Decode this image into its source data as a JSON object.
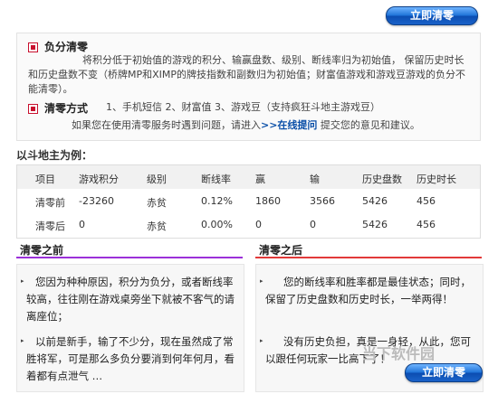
{
  "top_button": {
    "label": "立即清零"
  },
  "bottom_button": {
    "label": "立即清零"
  },
  "info": {
    "negative": {
      "title": "负分清零",
      "body": "将积分低于初始值的游戏的积分、输赢盘数、级别、断线率归为初始值， 保留历史时长和历史盘数不变（桥牌MP和XIMP的牌技指数和副数归为初始值；财富值游戏和游戏豆游戏的负分不能清零）。"
    },
    "method": {
      "title": "清零方式",
      "options": "1、手机短信 2、财富值 3、游戏豆（支持疯狂斗地主游戏豆）",
      "help_prefix": "如果您在使用清零服务时遇到问题，请进入",
      "help_link": ">>在线提问",
      "help_suffix": " 提交您的意见和建议。"
    }
  },
  "example": {
    "title": "以斗地主为例：",
    "headers": [
      "项目",
      "游戏积分",
      "级别",
      "断线率",
      "赢",
      "输",
      "历史盘数",
      "历史时长"
    ],
    "rows": [
      [
        "清零前",
        "-23260",
        "赤贫",
        "0.12%",
        "1860",
        "3566",
        "5426",
        "456"
      ],
      [
        "清零后",
        "0",
        "赤贫",
        "0.00%",
        "0",
        "0",
        "5426",
        "456"
      ]
    ]
  },
  "before": {
    "title": "清零之前",
    "p1": "您因为种种原因，积分为负分，或者断线率较高，往往刚在游戏桌旁坐下就被不客气的请离座位；",
    "p2": "以前是新手，输了不少分，现在虽然成了常胜将军，可是那么多负分要消到何年何月，看着都有点泄气 …"
  },
  "after": {
    "title": "清零之后",
    "p1": "您的断线率和胜率都是最佳状态；同时，保留了历史盘数和历史时长，一举两得！",
    "p2": "没有历史负担，真是一身轻，从此，您可以跟任何玩家一比高下了！"
  },
  "watermark": "当下软件园",
  "colors": {
    "accent_red": "#c8102e",
    "before_line": "#9b30d9",
    "after_line": "#e23a3a",
    "button_blue": "#1f73d8"
  }
}
